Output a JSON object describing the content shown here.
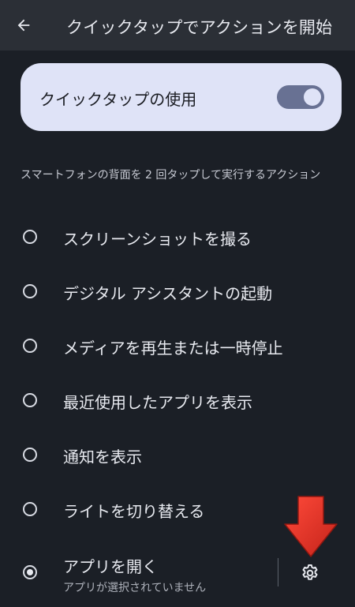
{
  "header": {
    "title": "クイックタップでアクションを開始",
    "back_icon": "arrow-back-icon"
  },
  "toggle": {
    "label": "クイックタップの使用",
    "enabled": true
  },
  "section": {
    "description": "スマートフォンの背面を 2 回タップして実行するアクション"
  },
  "options": [
    {
      "label": "スクリーンショットを撮る",
      "selected": false
    },
    {
      "label": "デジタル アシスタントの起動",
      "selected": false
    },
    {
      "label": "メディアを再生または一時停止",
      "selected": false
    },
    {
      "label": "最近使用したアプリを表示",
      "selected": false
    },
    {
      "label": "通知を表示",
      "selected": false
    },
    {
      "label": "ライトを切り替える",
      "selected": false
    },
    {
      "label": "アプリを開く",
      "sublabel": "アプリが選択されていません",
      "selected": true
    }
  ],
  "settings_icon": "gear-icon",
  "colors": {
    "background": "#1b1f26",
    "topbar": "#2b2f36",
    "card": "#dfe3f7",
    "switch_track": "#687193",
    "annotation_arrow": "#e53a2c"
  }
}
